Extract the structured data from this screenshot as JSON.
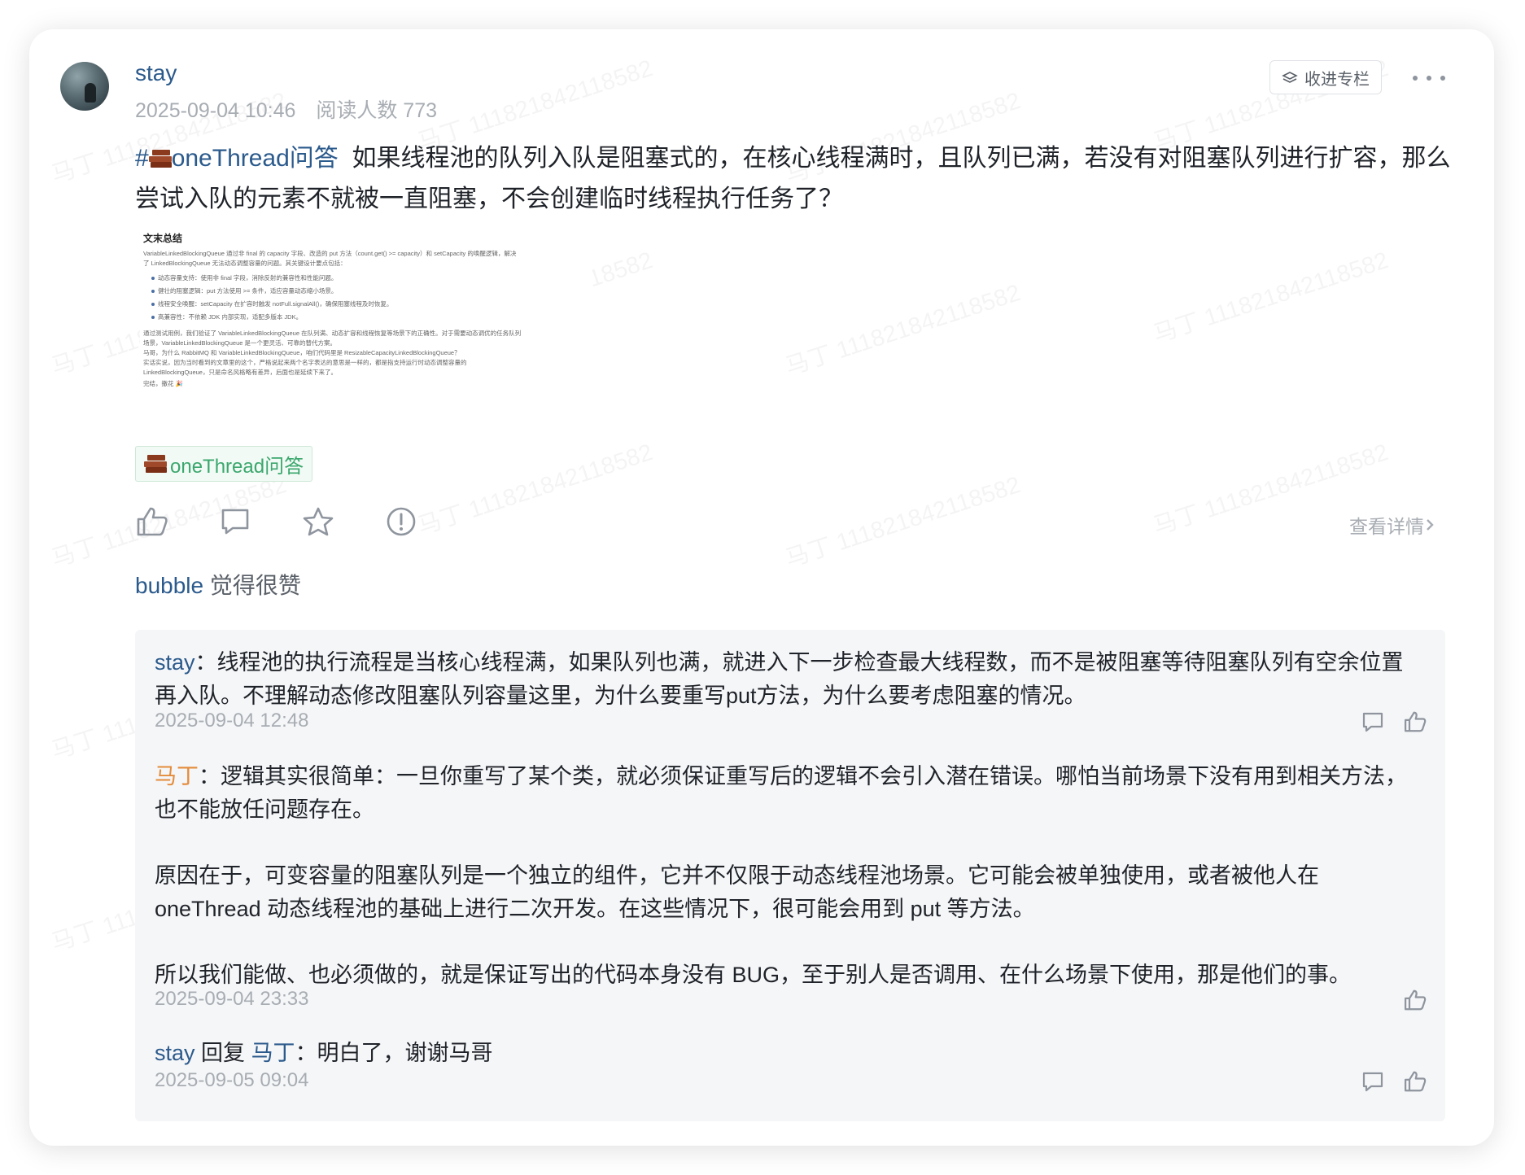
{
  "post": {
    "author": "stay",
    "date": "2025-09-04 10:46",
    "reads": "阅读人数 773",
    "collect_label": "收进专栏",
    "topic": "#🧱oneThread问答",
    "topic_text": "oneThread问答",
    "body": "如果线程池的队列入队是阻塞式的，在核心线程满时，且队列已满，若没有对阻塞队列进行扩容，那么尝试入队的元素不就被一直阻塞，不会创建临时线程执行任务了？",
    "tag_label": "oneThread问答",
    "detail_label": "查看详情",
    "liked_by": "bubble",
    "liked_suffix": "觉得很赞"
  },
  "watermark_text": "马丁 111821842118582",
  "preview": {
    "title": "文末总结",
    "lines": [
      "VariableLinkedBlockingQueue 通过非 final 的 capacity 字段、改造的 put 方法（count.get() >= capacity）和 setCapacity 的唤醒逻辑，解决",
      "了 LinkedBlockingQueue 无法动态调整容量的问题。其关键设计要点包括：",
      "动态容量支持：使用非 final 字段，消除反射的兼容性和性能问题。",
      "健壮的阻塞逻辑：put 方法使用 >= 条件，适应容量动态缩小场景。",
      "线程安全唤醒：setCapacity 在扩容时触发 notFull.signalAll()，确保阻塞线程及时恢复。",
      "高兼容性：不依赖 JDK 内部实现，适配多版本 JDK。",
      "通过测试用例，我们验证了 VariableLinkedBlockingQueue 在队列满、动态扩容和线程恢复等场景下的正确性。对于需要动态调优的任务队列",
      "场景，VariableLinkedBlockingQueue 是一个更灵活、可靠的替代方案。",
      "马哥，为什么 RabbitMQ 和 VariableLinkedBlockingQueue，咱们代码里是 ResizableCapacityLinkedBlockingQueue？",
      "实话实说，因为当时看到的文章里的这个，严格说起来两个名字表达的意思是一样的，都是指支持运行时动态调整容量的",
      "LinkedBlockingQueue，只是命名风格略有差异，后面也是延续下来了。",
      "完结，撒花 🎉"
    ]
  },
  "comments": [
    {
      "author": "stay",
      "text": "：线程池的执行流程是当核心线程满，如果队列也满，就进入下一步检查最大线程数，而不是被阻塞等待阻塞队列有空余位置再入队。不理解动态修改阻塞队列容量这里，为什么要重写put方法，为什么要考虑阻塞的情况。",
      "time": "2025-09-04 12:48"
    },
    {
      "author": "马丁",
      "para1": "：逻辑其实很简单：一旦你重写了某个类，就必须保证重写后的逻辑不会引入潜在错误。哪怕当前场景下没有用到相关方法，也不能放任问题存在。",
      "para2": "原因在于，可变容量的阻塞队列是一个独立的组件，它并不仅限于动态线程池场景。它可能会被单独使用，或者被他人在 oneThread 动态线程池的基础上进行二次开发。在这些情况下，很可能会用到 put 等方法。",
      "para3": "所以我们能做、也必须做的，就是保证写出的代码本身没有 BUG，至于别人是否调用、在什么场景下使用，那是他们的事。",
      "time": "2025-09-04 23:33"
    },
    {
      "author": "stay",
      "reply_word": "回复",
      "reply_to": "马丁",
      "text": "：明白了，谢谢马哥",
      "time": "2025-09-05 09:04"
    }
  ]
}
